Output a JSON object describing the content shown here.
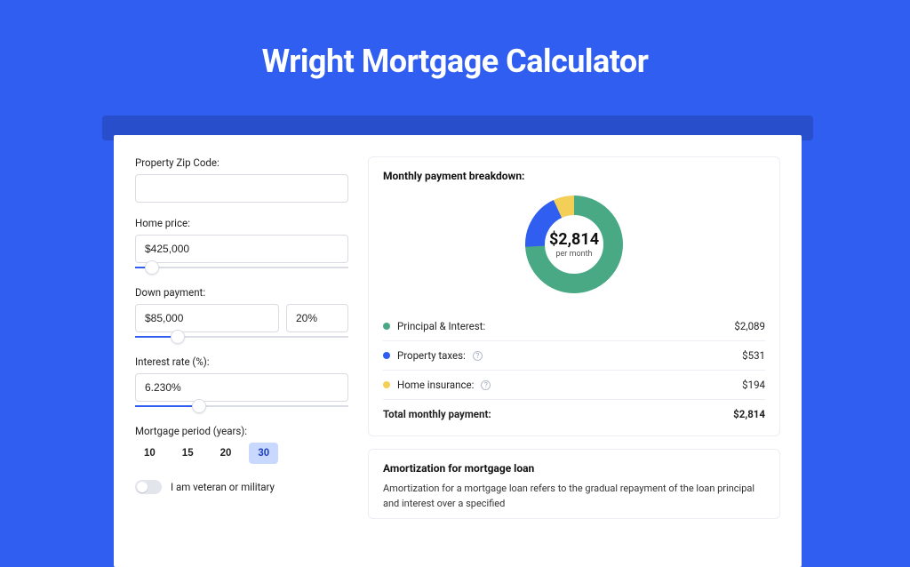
{
  "page": {
    "title": "Wright Mortgage Calculator"
  },
  "form": {
    "zip_label": "Property Zip Code:",
    "zip_value": "",
    "home_price_label": "Home price:",
    "home_price_value": "$425,000",
    "home_price_slider_pct": 8,
    "down_payment_label": "Down payment:",
    "down_payment_value": "$85,000",
    "down_payment_pct_value": "20%",
    "down_payment_slider_pct": 20,
    "interest_label": "Interest rate (%):",
    "interest_value": "6.230%",
    "interest_slider_pct": 30,
    "period_label": "Mortgage period (years):",
    "periods": [
      "10",
      "15",
      "20",
      "30"
    ],
    "period_active_index": 3,
    "veteran_label": "I am veteran or military",
    "veteran_on": false
  },
  "breakdown": {
    "title": "Monthly payment breakdown:",
    "center_amount": "$2,814",
    "center_sub": "per month",
    "items": [
      {
        "label": "Principal & Interest:",
        "value": "$2,089",
        "color": "#49a985",
        "has_info": false,
        "pct": 74.2
      },
      {
        "label": "Property taxes:",
        "value": "$531",
        "color": "#2f5ef0",
        "has_info": true,
        "pct": 18.9
      },
      {
        "label": "Home insurance:",
        "value": "$194",
        "color": "#f3cf58",
        "has_info": true,
        "pct": 6.9
      }
    ],
    "total_label": "Total monthly payment:",
    "total_value": "$2,814"
  },
  "amortization": {
    "title": "Amortization for mortgage loan",
    "text": "Amortization for a mortgage loan refers to the gradual repayment of the loan principal and interest over a specified"
  },
  "chart_data": {
    "type": "pie",
    "title": "Monthly payment breakdown",
    "categories": [
      "Principal & Interest",
      "Property taxes",
      "Home insurance"
    ],
    "values": [
      2089,
      531,
      194
    ],
    "colors": [
      "#49a985",
      "#2f5ef0",
      "#f3cf58"
    ],
    "total": 2814,
    "unit": "USD per month"
  }
}
